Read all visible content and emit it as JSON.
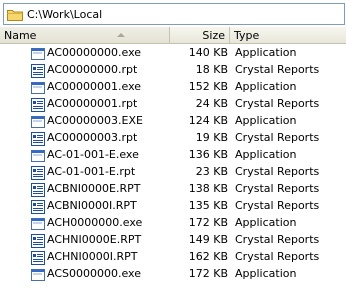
{
  "address": {
    "path": "C:\\Work\\Local"
  },
  "header": {
    "name": "Name",
    "size": "Size",
    "type": "Type"
  },
  "rows": [
    {
      "name": "AC00000000.exe",
      "size": "140 KB",
      "type": "Application",
      "icon": "application-icon"
    },
    {
      "name": "AC00000000.rpt",
      "size": "18 KB",
      "type": "Crystal Reports",
      "icon": "crystal-reports-icon"
    },
    {
      "name": "AC00000001.exe",
      "size": "152 KB",
      "type": "Application",
      "icon": "application-icon"
    },
    {
      "name": "AC00000001.rpt",
      "size": "24 KB",
      "type": "Crystal Reports",
      "icon": "crystal-reports-icon"
    },
    {
      "name": "AC00000003.EXE",
      "size": "124 KB",
      "type": "Application",
      "icon": "application-icon"
    },
    {
      "name": "AC00000003.rpt",
      "size": "19 KB",
      "type": "Crystal Reports",
      "icon": "crystal-reports-icon"
    },
    {
      "name": "AC-01-001-E.exe",
      "size": "136 KB",
      "type": "Application",
      "icon": "application-icon"
    },
    {
      "name": "AC-01-001-E.rpt",
      "size": "23 KB",
      "type": "Crystal Reports",
      "icon": "crystal-reports-icon"
    },
    {
      "name": "ACBNI0000E.RPT",
      "size": "138 KB",
      "type": "Crystal Reports",
      "icon": "crystal-reports-icon"
    },
    {
      "name": "ACBNI0000I.RPT",
      "size": "135 KB",
      "type": "Crystal Reports",
      "icon": "crystal-reports-icon"
    },
    {
      "name": "ACH0000000.exe",
      "size": "172 KB",
      "type": "Application",
      "icon": "application-icon"
    },
    {
      "name": "ACHNI0000E.RPT",
      "size": "149 KB",
      "type": "Crystal Reports",
      "icon": "crystal-reports-icon"
    },
    {
      "name": "ACHNI0000I.RPT",
      "size": "162 KB",
      "type": "Crystal Reports",
      "icon": "crystal-reports-icon"
    },
    {
      "name": "ACS0000000.exe",
      "size": "172 KB",
      "type": "Application",
      "icon": "application-icon"
    }
  ],
  "colors": {
    "header_bg": "#ebeadb",
    "address_border": "#7f9db9",
    "folder_yellow": "#f5d76e",
    "app_icon_blue": "#316ac5",
    "rpt_icon_blue": "#1f4e9c"
  }
}
